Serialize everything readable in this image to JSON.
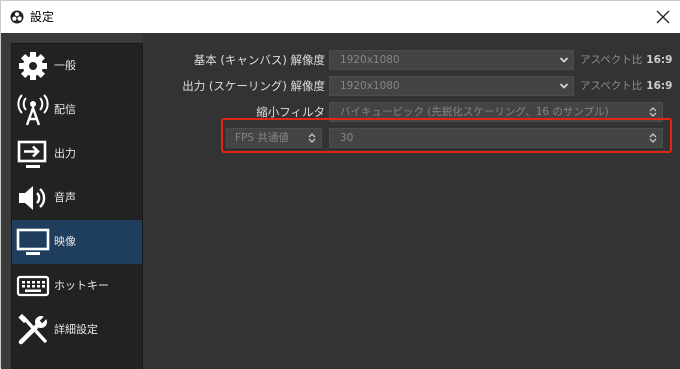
{
  "window": {
    "title": "設定"
  },
  "sidebar": {
    "items": [
      {
        "label": "一般",
        "icon": "gear-icon",
        "selected": false
      },
      {
        "label": "配信",
        "icon": "broadcast-icon",
        "selected": false
      },
      {
        "label": "出力",
        "icon": "output-icon",
        "selected": false
      },
      {
        "label": "音声",
        "icon": "speaker-icon",
        "selected": false
      },
      {
        "label": "映像",
        "icon": "monitor-icon",
        "selected": true
      },
      {
        "label": "ホットキー",
        "icon": "keyboard-icon",
        "selected": false
      },
      {
        "label": "詳細設定",
        "icon": "tools-icon",
        "selected": false
      }
    ]
  },
  "video": {
    "base_resolution": {
      "label": "基本 (キャンバス) 解像度",
      "value": "1920x1080",
      "aspect_label": "アスペクト比",
      "aspect_value": "16:9"
    },
    "output_resolution": {
      "label": "出力 (スケーリング) 解像度",
      "value": "1920x1080",
      "aspect_label": "アスペクト比",
      "aspect_value": "16:9"
    },
    "downscale_filter": {
      "label": "縮小フィルタ",
      "value": "バイキュービック (先鋭化スケーリング、16 のサンプル)"
    },
    "fps": {
      "type_value": "FPS 共通値",
      "value": "30"
    }
  },
  "colors": {
    "highlight": "#e02617",
    "selected": "#1f3e5d"
  }
}
